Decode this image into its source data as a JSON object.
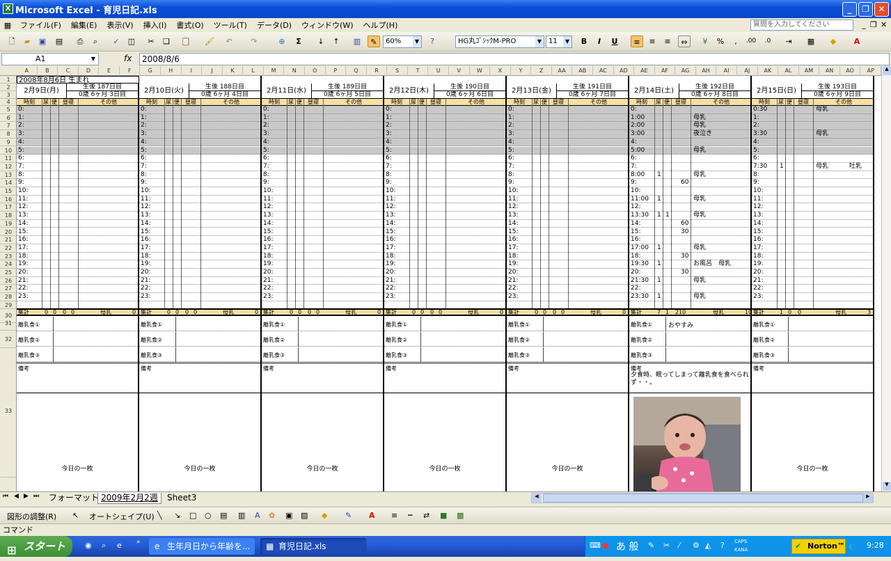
{
  "window": {
    "title": "Microsoft Excel - 育児日記.xls"
  },
  "menu": {
    "items": [
      "ファイル(F)",
      "編集(E)",
      "表示(V)",
      "挿入(I)",
      "書式(O)",
      "ツール(T)",
      "データ(D)",
      "ウィンドウ(W)",
      "ヘルプ(H)"
    ],
    "help_search_placeholder": "質問を入力してください"
  },
  "toolbar": {
    "zoom": "60%",
    "font_name": "HG丸ｺﾞｼｯｸM-PRO",
    "font_size": "11",
    "bold": "B",
    "italic": "I",
    "underline": "U"
  },
  "formula_bar": {
    "cell_ref": "A1",
    "fx_label": "fx",
    "value": "2008/8/6"
  },
  "columns": [
    "A",
    "B",
    "C",
    "D",
    "E",
    "F",
    "G",
    "H",
    "I",
    "J",
    "K",
    "L",
    "M",
    "N",
    "O",
    "P",
    "Q",
    "R",
    "S",
    "T",
    "U",
    "V",
    "W",
    "X",
    "Y",
    "Z",
    "AA",
    "AB",
    "AC",
    "AD",
    "AE",
    "AF",
    "AG",
    "AH",
    "AI",
    "AJ",
    "AK",
    "AL",
    "AM",
    "AN",
    "AO",
    "AP"
  ],
  "row_numbers": [
    "1",
    "2",
    "3",
    "4",
    "5",
    "6",
    "7",
    "8",
    "9",
    "10",
    "11",
    "12",
    "13",
    "14",
    "15",
    "16",
    "17",
    "18",
    "19",
    "20",
    "21",
    "22",
    "23",
    "24",
    "25",
    "26",
    "27",
    "28",
    "29",
    "30",
    "31",
    "32",
    "33"
  ],
  "sheet": {
    "birth_line": "2008年8月6日 生まれ",
    "headers": {
      "time": "時刻",
      "pee": "尿",
      "poop": "便",
      "sleep": "昼寝",
      "other": "その他"
    },
    "sum_label": "集計",
    "sum_milk": "母乳",
    "baby_food": [
      "離乳食①",
      "離乳食②",
      "離乳食③"
    ],
    "memo_label": "備考",
    "photo_label": "今日の一枚",
    "days": [
      {
        "date": "2月9日(月)",
        "age1": "生後 187日目",
        "age2": "0歳 6ヶ月 3日目",
        "sum": [
          "0",
          "0",
          "0",
          "0"
        ],
        "sum_tail": "0",
        "memo": "",
        "baby_food_values": [
          "",
          "",
          ""
        ],
        "times": [
          "0:",
          "1:",
          "2:",
          "3:",
          "4:",
          "5:",
          "6:",
          "7:",
          "8:",
          "9:",
          "10:",
          "11:",
          "12:",
          "13:",
          "14:",
          "15:",
          "16:",
          "17:",
          "18:",
          "19:",
          "20:",
          "21:",
          "22:",
          "23:"
        ],
        "pee": [],
        "sleep": [],
        "other": [],
        "other2": []
      },
      {
        "date": "2月10日(火)",
        "age1": "生後 188日目",
        "age2": "0歳 6ヶ月 4日目",
        "sum": [
          "0",
          "0",
          "0",
          "0"
        ],
        "sum_tail": "0",
        "memo": "",
        "baby_food_values": [
          "",
          "",
          ""
        ],
        "times": [
          "0:",
          "1:",
          "2:",
          "3:",
          "4:",
          "5:",
          "6:",
          "7:",
          "8:",
          "9:",
          "10:",
          "11:",
          "12:",
          "13:",
          "14:",
          "15:",
          "16:",
          "17:",
          "18:",
          "19:",
          "20:",
          "21:",
          "22:",
          "23:"
        ],
        "pee": [],
        "sleep": [],
        "other": [],
        "other2": []
      },
      {
        "date": "2月11日(水)",
        "age1": "生後 189日目",
        "age2": "0歳 6ヶ月 5日目",
        "sum": [
          "0",
          "0",
          "0",
          "0"
        ],
        "sum_tail": "0",
        "memo": "",
        "baby_food_values": [
          "",
          "",
          ""
        ],
        "times": [
          "0:",
          "1:",
          "2:",
          "3:",
          "4:",
          "5:",
          "6:",
          "7:",
          "8:",
          "9:",
          "10:",
          "11:",
          "12:",
          "13:",
          "14:",
          "15:",
          "16:",
          "17:",
          "18:",
          "19:",
          "20:",
          "21:",
          "22:",
          "23:"
        ],
        "pee": [],
        "sleep": [],
        "other": [],
        "other2": []
      },
      {
        "date": "2月12日(木)",
        "age1": "生後 190日目",
        "age2": "0歳 6ヶ月 6日目",
        "sum": [
          "0",
          "0",
          "0",
          "0"
        ],
        "sum_tail": "0",
        "memo": "",
        "baby_food_values": [
          "",
          "",
          ""
        ],
        "times": [
          "0:",
          "1:",
          "2:",
          "3:",
          "4:",
          "5:",
          "6:",
          "7:",
          "8:",
          "9:",
          "10:",
          "11:",
          "12:",
          "13:",
          "14:",
          "15:",
          "16:",
          "17:",
          "18:",
          "19:",
          "20:",
          "21:",
          "22:",
          "23:"
        ],
        "pee": [],
        "sleep": [],
        "other": [],
        "other2": []
      },
      {
        "date": "2月13日(金)",
        "age1": "生後 191日目",
        "age2": "0歳 6ヶ月 7日目",
        "sum": [
          "0",
          "0",
          "0",
          "0"
        ],
        "sum_tail": "0",
        "memo": "",
        "baby_food_values": [
          "",
          "",
          ""
        ],
        "times": [
          "0:",
          "1:",
          "2:",
          "3:",
          "4:",
          "5:",
          "6:",
          "7:",
          "8:",
          "9:",
          "10:",
          "11:",
          "12:",
          "13:",
          "14:",
          "15:",
          "16:",
          "17:",
          "18:",
          "19:",
          "20:",
          "21:",
          "22:",
          "23:"
        ],
        "pee": [],
        "sleep": [],
        "other": [],
        "other2": []
      },
      {
        "date": "2月14日(土)",
        "age1": "生後 192日目",
        "age2": "0歳 6ヶ月 8日目",
        "sum": [
          "7",
          "1",
          "210"
        ],
        "sum_tail": "10",
        "memo": "夕食時、眠ってしまって離乳食を食べられず・・。",
        "baby_food_values": [
          "おやすみ",
          "",
          ""
        ],
        "times": [
          "0:",
          "1:00",
          "2:00",
          "3:00",
          "4:",
          "5:00",
          "6:",
          "7:",
          "8:00",
          "9:",
          "10:",
          "11:00",
          "12:",
          "13:30",
          "14:",
          "15:",
          "16:",
          "17:00",
          "18:",
          "19:30",
          "20:",
          "21:30",
          "22:",
          "23:30"
        ],
        "pee": [
          "",
          "",
          "",
          "",
          "",
          "",
          "",
          "",
          "1",
          "",
          "",
          "1",
          "",
          "1",
          "",
          "",
          "",
          "1",
          "",
          "1",
          "",
          "1",
          "",
          "1"
        ],
        "poop": [
          "",
          "",
          "",
          "",
          "",
          "",
          "",
          "",
          "",
          "",
          "",
          "",
          "",
          "1",
          "",
          "",
          "",
          "",
          "",
          "",
          "",
          "",
          "",
          ""
        ],
        "sleep": [
          "",
          "",
          "",
          "",
          "",
          "",
          "",
          "",
          "",
          "60",
          "",
          "",
          "",
          "",
          "60",
          "30",
          "",
          "",
          "30",
          "",
          "30",
          "",
          "",
          ""
        ],
        "other": [
          "",
          "母乳",
          "母乳",
          "夜泣き",
          "",
          "母乳",
          "",
          "",
          "母乳",
          "",
          "",
          "母乳",
          "",
          "母乳",
          "",
          "",
          "",
          "母乳",
          "",
          "お風呂　母乳",
          "",
          "母乳",
          "",
          "母乳"
        ],
        "other2": []
      },
      {
        "date": "2月15日(日)",
        "age1": "生後 193日目",
        "age2": "0歳 6ヶ月 9日目",
        "sum": [
          "1",
          "0",
          "0"
        ],
        "sum_tail": "3",
        "memo": "",
        "baby_food_values": [
          "",
          "",
          ""
        ],
        "times": [
          "0:30",
          "1:",
          "2:",
          "3:30",
          "4:",
          "5:",
          "6:",
          "7:30",
          "8:",
          "9:",
          "10:",
          "11:",
          "12:",
          "13:",
          "14:",
          "15:",
          "16:",
          "17:",
          "18:",
          "19:",
          "20:",
          "21:",
          "22:",
          "23:"
        ],
        "pee": [
          "",
          "",
          "",
          "",
          "",
          "",
          "",
          "1",
          "",
          "",
          "",
          "",
          "",
          "",
          "",
          "",
          "",
          "",
          "",
          "",
          "",
          "",
          "",
          ""
        ],
        "sleep": [],
        "other": [
          "母乳",
          "",
          "",
          "母乳",
          "",
          "",
          "",
          "母乳",
          "",
          "",
          "",
          "",
          "",
          "",
          "",
          "",
          "",
          "",
          "",
          "",
          "",
          "",
          "",
          ""
        ],
        "other2": [
          "",
          "",
          "",
          "",
          "",
          "",
          "",
          "吐乳",
          "",
          "",
          "",
          "",
          "",
          "",
          "",
          "",
          "",
          "",
          "",
          "",
          "",
          "",
          "",
          ""
        ]
      }
    ]
  },
  "sheet_tabs": [
    "フォーマット",
    "2009年2月2週",
    "Sheet3"
  ],
  "drawing_toolbar": {
    "adjust": "図形の調整(R)",
    "autoshape": "オートシェイプ(U)"
  },
  "status": "コマンド",
  "taskbar": {
    "start": "スタート",
    "tasks": [
      "生年月日から年齢を...",
      "育児日記.xls"
    ],
    "norton": "Norton™",
    "clock": "9:28",
    "ime": "あ 般",
    "caps": "CAPS",
    "kana": "KANA"
  }
}
